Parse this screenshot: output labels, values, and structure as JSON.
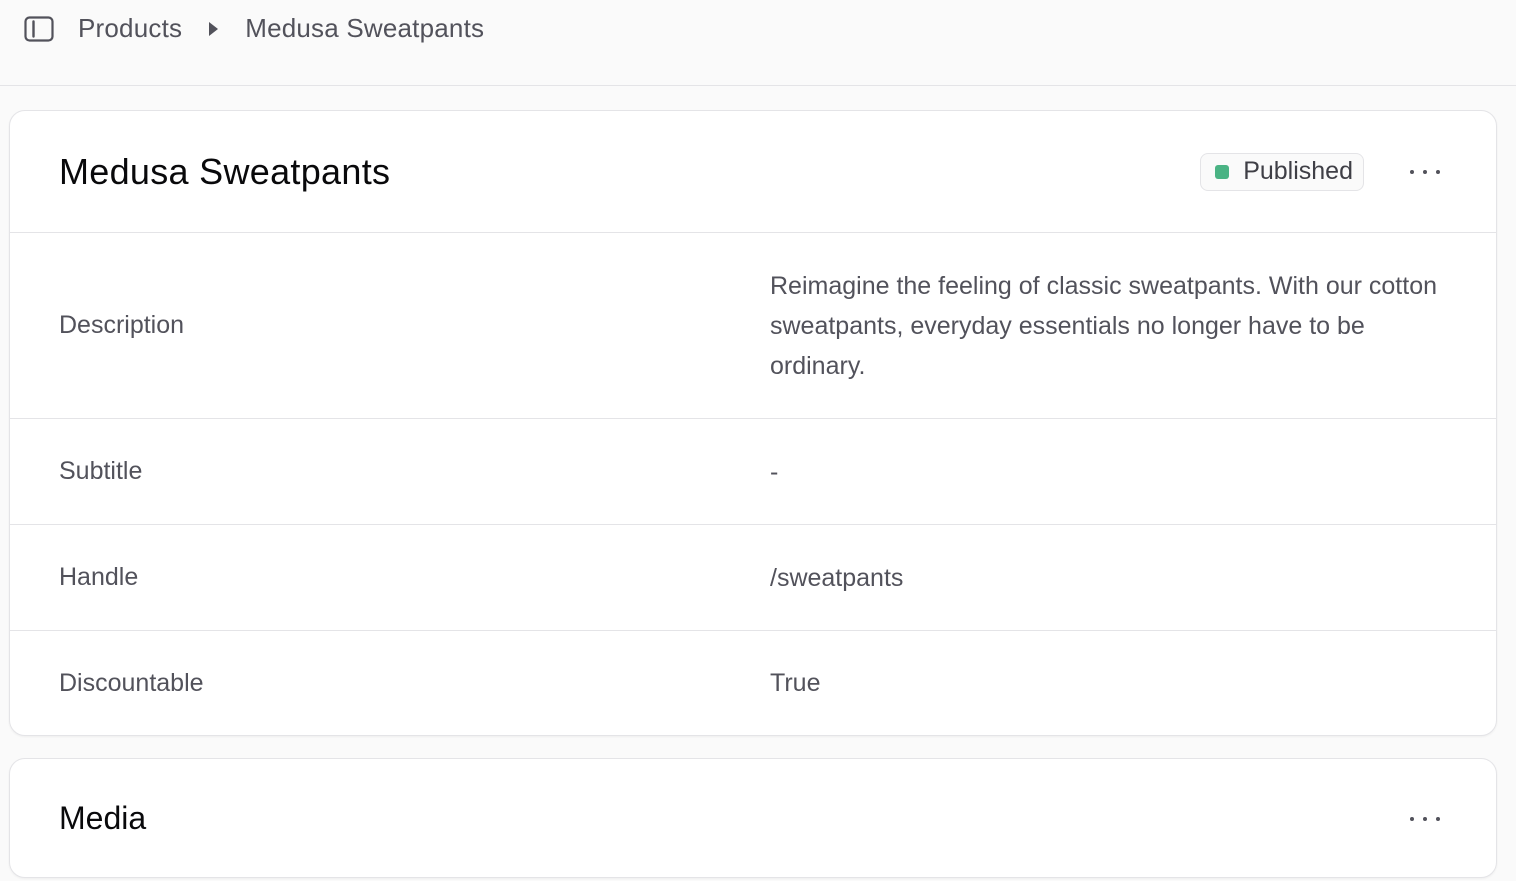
{
  "breadcrumb": {
    "items": [
      "Products",
      "Medusa Sweatpants"
    ]
  },
  "product": {
    "title": "Medusa Sweatpants",
    "status": "Published",
    "status_color": "#4ab384"
  },
  "fields": {
    "description": {
      "label": "Description",
      "value": "Reimagine the feeling of classic sweatpants. With our cotton sweatpants, everyday essentials no longer have to be ordinary."
    },
    "subtitle": {
      "label": "Subtitle",
      "value": "-"
    },
    "handle": {
      "label": "Handle",
      "value": "/sweatpants"
    },
    "discountable": {
      "label": "Discountable",
      "value": "True"
    }
  },
  "media": {
    "title": "Media"
  },
  "icons": {
    "sidebar_toggle": "sidebar-toggle-icon",
    "breadcrumb_separator": "triangle-right-icon",
    "more": "ellipsis-horizontal-icon"
  }
}
